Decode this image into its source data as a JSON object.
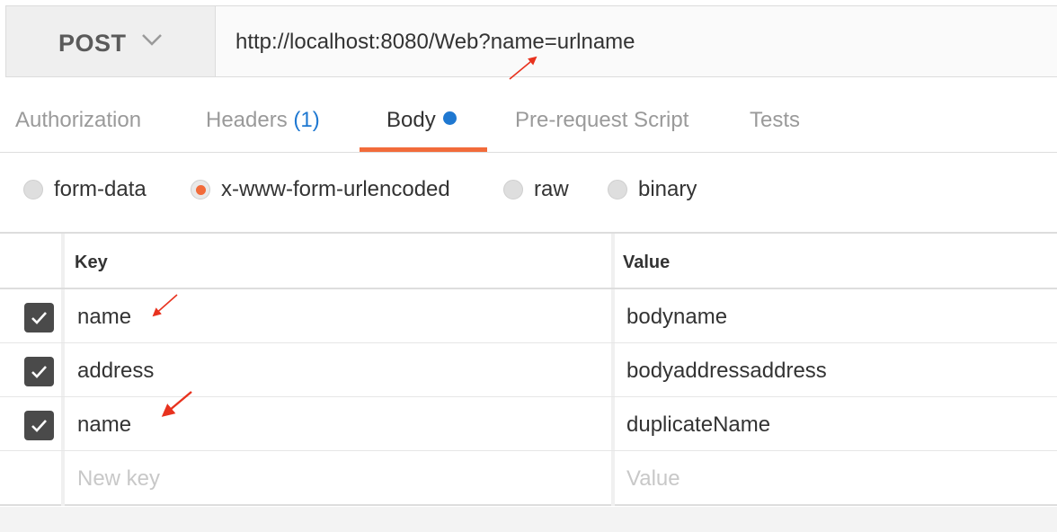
{
  "request": {
    "method": "POST",
    "url": "http://localhost:8080/Web?name=urlname"
  },
  "tabs": [
    {
      "label": "Authorization"
    },
    {
      "label": "Headers",
      "count": "(1)"
    },
    {
      "label": "Body",
      "active": true
    },
    {
      "label": "Pre-request Script"
    },
    {
      "label": "Tests"
    }
  ],
  "body_types": [
    {
      "label": "form-data",
      "selected": false
    },
    {
      "label": "x-www-form-urlencoded",
      "selected": true
    },
    {
      "label": "raw",
      "selected": false
    },
    {
      "label": "binary",
      "selected": false
    }
  ],
  "table": {
    "headers": {
      "key": "Key",
      "value": "Value"
    },
    "rows": [
      {
        "checked": true,
        "key": "name",
        "value": "bodyname"
      },
      {
        "checked": true,
        "key": "address",
        "value": "bodyaddressaddress"
      },
      {
        "checked": true,
        "key": "name",
        "value": "duplicateName"
      }
    ],
    "new_row": {
      "key_placeholder": "New key",
      "value_placeholder": "Value"
    }
  },
  "colors": {
    "accent": "#f26b3a",
    "link": "#1f78d1",
    "annotation": "#e8321e"
  },
  "icons": [
    "chevron-down-icon",
    "checkmark-icon",
    "status-dot-icon"
  ]
}
